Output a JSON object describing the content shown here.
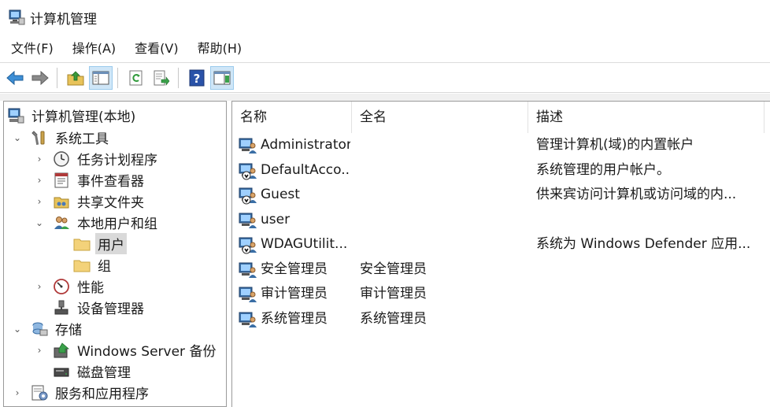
{
  "window": {
    "title": "计算机管理"
  },
  "menu": [
    "文件(F)",
    "操作(A)",
    "查看(V)",
    "帮助(H)"
  ],
  "toolbar": {
    "buttons": [
      "back-arrow-icon",
      "forward-arrow-icon",
      "up-folder-icon",
      "show-hide-tree-icon",
      "refresh-icon",
      "export-list-icon",
      "help-icon",
      "action-pane-icon"
    ]
  },
  "tree": {
    "root": "计算机管理(本地)",
    "system_tools": "系统工具",
    "task_scheduler": "任务计划程序",
    "event_viewer": "事件查看器",
    "shared_folders": "共享文件夹",
    "local_users_groups": "本地用户和组",
    "users": "用户",
    "groups": "组",
    "performance": "性能",
    "device_manager": "设备管理器",
    "storage": "存储",
    "windows_server_backup": "Windows Server 备份",
    "disk_management": "磁盘管理",
    "services_apps": "服务和应用程序"
  },
  "list": {
    "columns": [
      "名称",
      "全名",
      "描述"
    ],
    "rows": [
      {
        "name": "Administrator",
        "fullname": "",
        "desc": "管理计算机(域)的内置帐户",
        "disabled": false
      },
      {
        "name": "DefaultAcco...",
        "fullname": "",
        "desc": "系统管理的用户帐户。",
        "disabled": true
      },
      {
        "name": "Guest",
        "fullname": "",
        "desc": "供来宾访问计算机或访问域的内...",
        "disabled": true
      },
      {
        "name": "user",
        "fullname": "",
        "desc": "",
        "disabled": false
      },
      {
        "name": "WDAGUtilit...",
        "fullname": "",
        "desc": "系统为 Windows Defender 应用...",
        "disabled": true
      },
      {
        "name": "安全管理员",
        "fullname": "安全管理员",
        "desc": "",
        "disabled": false
      },
      {
        "name": "审计管理员",
        "fullname": "审计管理员",
        "desc": "",
        "disabled": false
      },
      {
        "name": "系统管理员",
        "fullname": "系统管理员",
        "desc": "",
        "disabled": false
      }
    ]
  }
}
